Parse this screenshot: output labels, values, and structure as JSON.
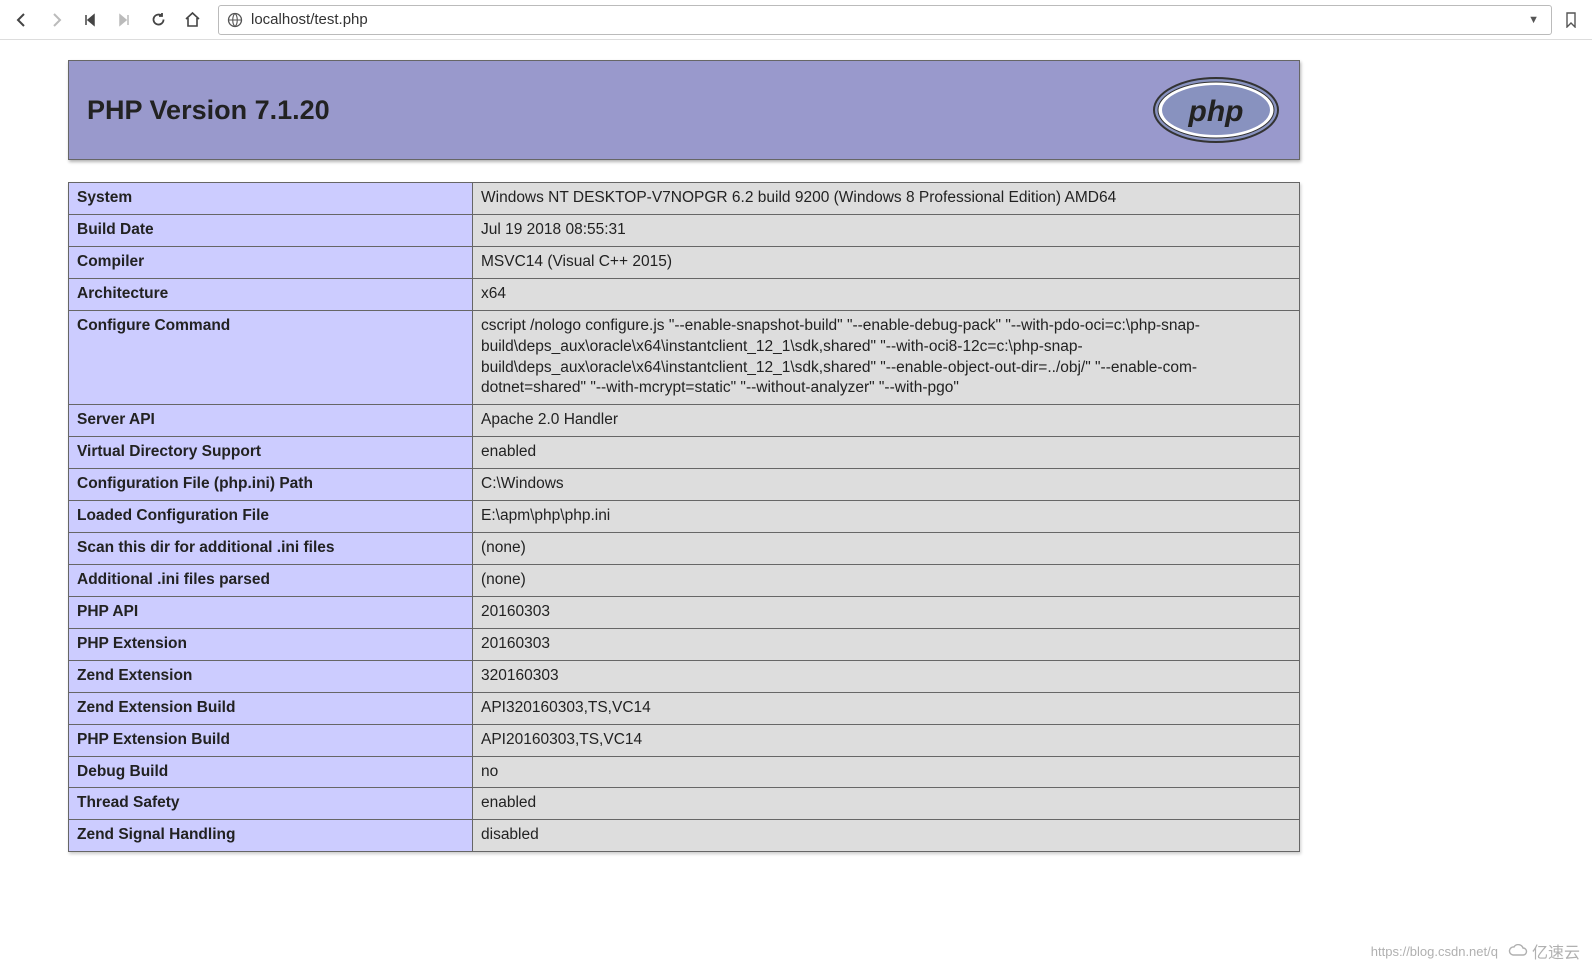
{
  "browser": {
    "url": "localhost/test.php"
  },
  "header": {
    "title": "PHP Version 7.1.20"
  },
  "rows": [
    {
      "key": "System",
      "val": "Windows NT DESKTOP-V7NOPGR 6.2 build 9200 (Windows 8 Professional Edition) AMD64"
    },
    {
      "key": "Build Date",
      "val": "Jul 19 2018 08:55:31"
    },
    {
      "key": "Compiler",
      "val": "MSVC14 (Visual C++ 2015)"
    },
    {
      "key": "Architecture",
      "val": "x64"
    },
    {
      "key": "Configure Command",
      "val": "cscript /nologo configure.js \"--enable-snapshot-build\" \"--enable-debug-pack\" \"--with-pdo-oci=c:\\php-snap-build\\deps_aux\\oracle\\x64\\instantclient_12_1\\sdk,shared\" \"--with-oci8-12c=c:\\php-snap-build\\deps_aux\\oracle\\x64\\instantclient_12_1\\sdk,shared\" \"--enable-object-out-dir=../obj/\" \"--enable-com-dotnet=shared\" \"--with-mcrypt=static\" \"--without-analyzer\" \"--with-pgo\""
    },
    {
      "key": "Server API",
      "val": "Apache 2.0 Handler"
    },
    {
      "key": "Virtual Directory Support",
      "val": "enabled"
    },
    {
      "key": "Configuration File (php.ini) Path",
      "val": "C:\\Windows"
    },
    {
      "key": "Loaded Configuration File",
      "val": "E:\\apm\\php\\php.ini"
    },
    {
      "key": "Scan this dir for additional .ini files",
      "val": "(none)"
    },
    {
      "key": "Additional .ini files parsed",
      "val": "(none)"
    },
    {
      "key": "PHP API",
      "val": "20160303"
    },
    {
      "key": "PHP Extension",
      "val": "20160303"
    },
    {
      "key": "Zend Extension",
      "val": "320160303"
    },
    {
      "key": "Zend Extension Build",
      "val": "API320160303,TS,VC14"
    },
    {
      "key": "PHP Extension Build",
      "val": "API20160303,TS,VC14"
    },
    {
      "key": "Debug Build",
      "val": "no"
    },
    {
      "key": "Thread Safety",
      "val": "enabled"
    },
    {
      "key": "Zend Signal Handling",
      "val": "disabled"
    }
  ],
  "watermark": {
    "text": "https://blog.csdn.net/q",
    "brand": "亿速云"
  }
}
